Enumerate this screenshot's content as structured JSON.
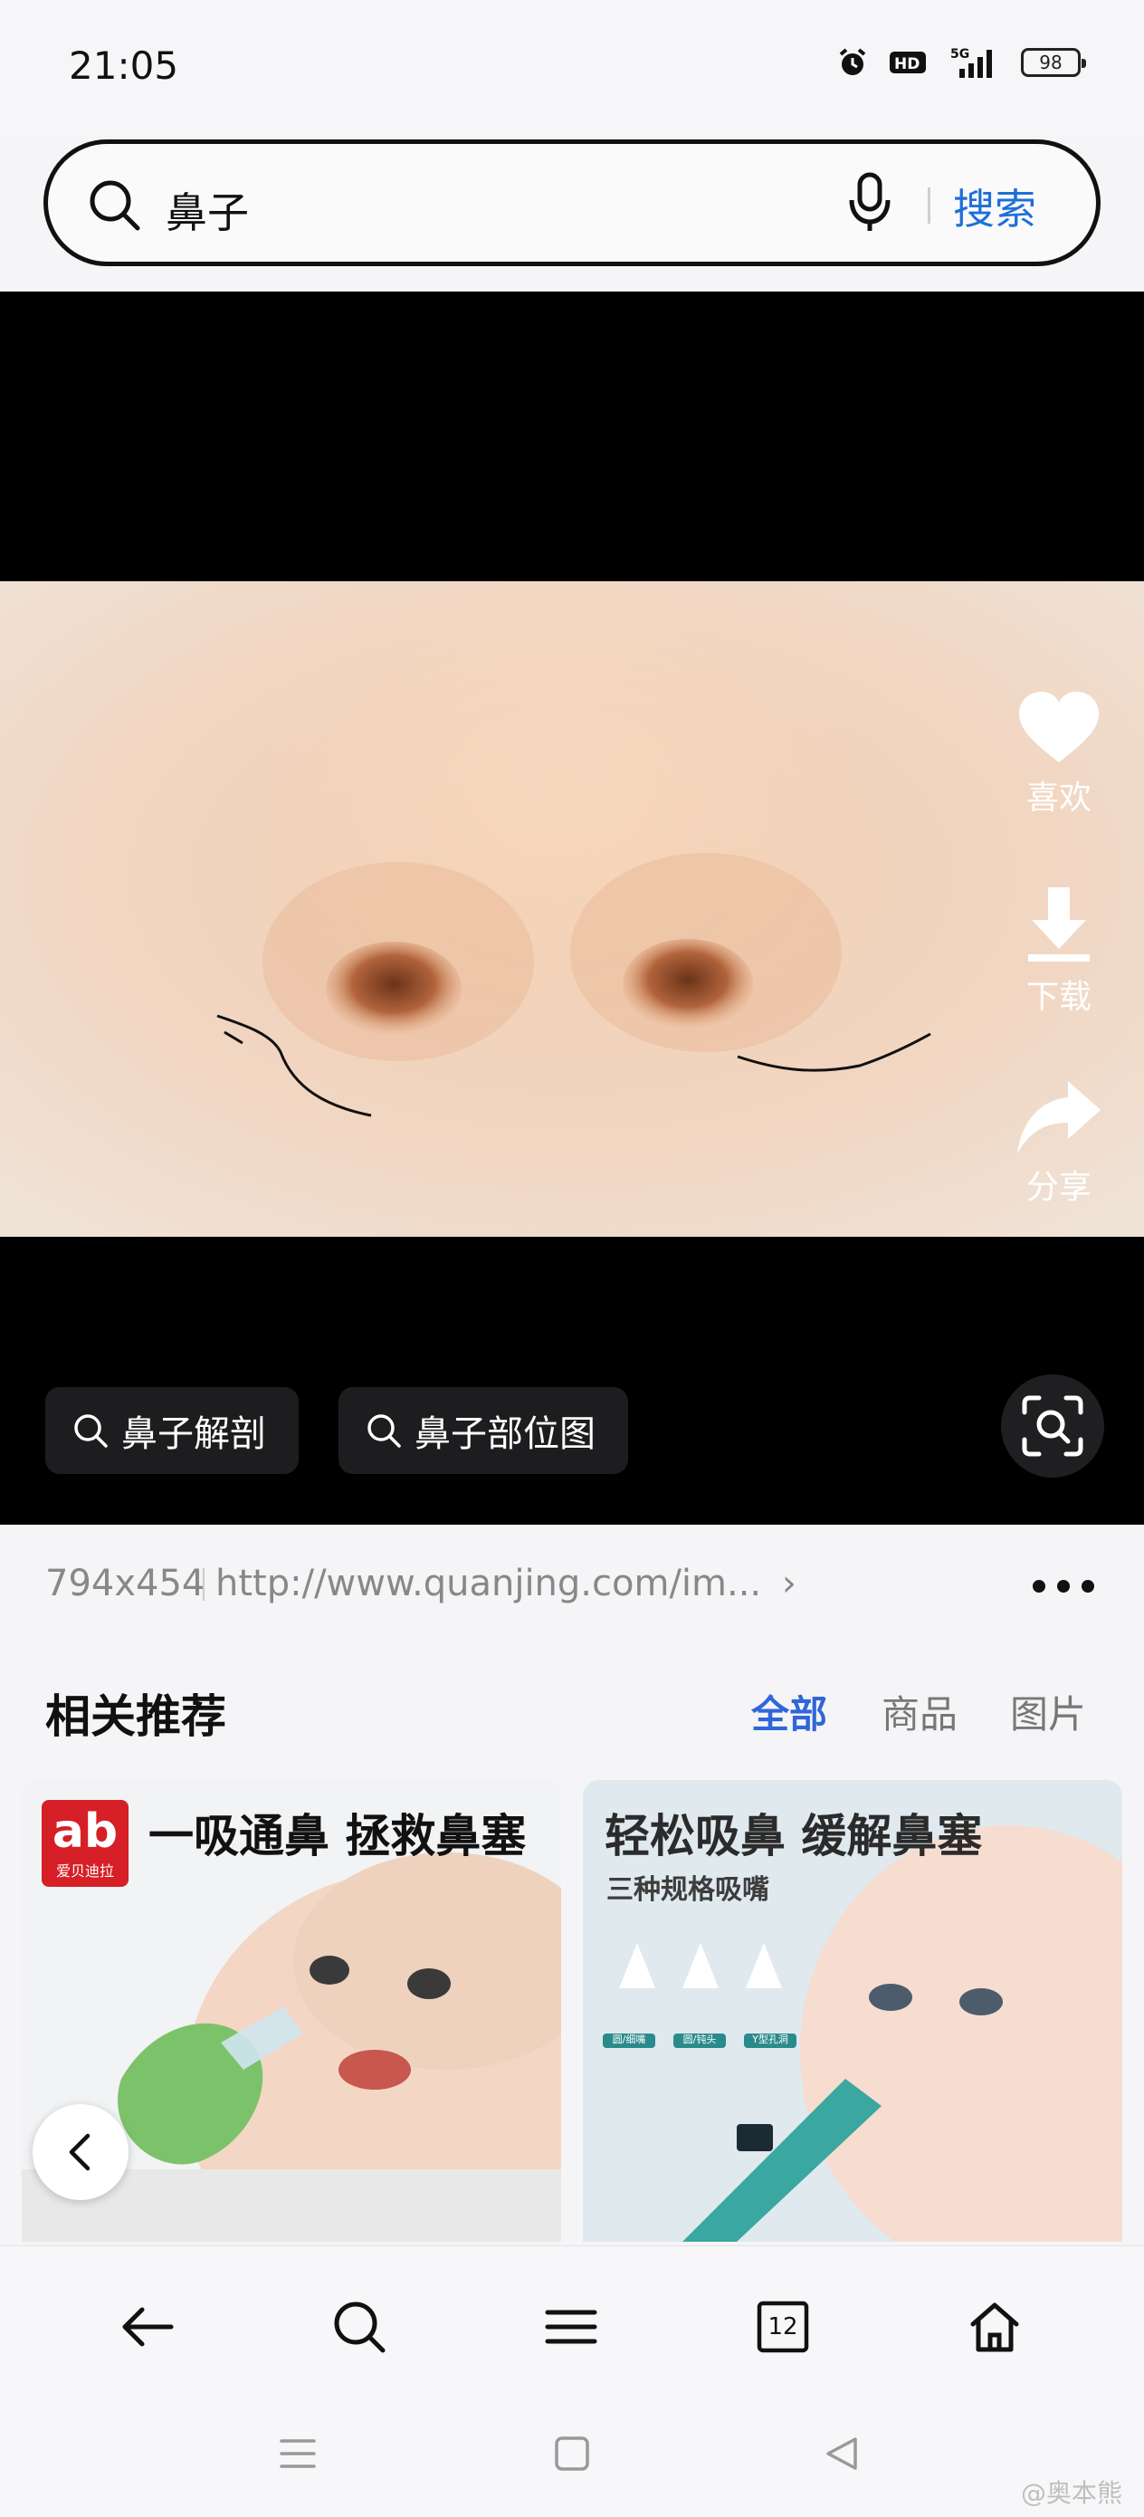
{
  "status_bar": {
    "time": "21:05",
    "battery": "98"
  },
  "search": {
    "query": "鼻子",
    "button_label": "搜索"
  },
  "viewer": {
    "actions": [
      {
        "label": "喜欢",
        "icon": "heart-icon"
      },
      {
        "label": "下载",
        "icon": "download-icon"
      },
      {
        "label": "分享",
        "icon": "share-icon"
      }
    ],
    "chips": [
      "鼻子解剖",
      "鼻子部位图"
    ]
  },
  "info": {
    "size": "794x454",
    "url": "http://www.quanjing.com/im..."
  },
  "related": {
    "title": "相关推荐",
    "tabs": [
      "全部",
      "商品",
      "图片"
    ],
    "cards": [
      {
        "title": "一吸通鼻 拯救鼻塞",
        "brand": "爱贝迪拉",
        "brand_mark": "ab"
      },
      {
        "title": "轻松吸鼻 缓解鼻塞",
        "subtitle": "三种规格吸嘴",
        "tip_labels": [
          "圆/细嘴",
          "圆/钝头",
          "Y型孔洞"
        ]
      }
    ]
  },
  "toolbar": {
    "tabs_count": "12"
  },
  "watermark": "@奥本熊",
  "colors": {
    "accent": "#1e6fd9",
    "tab_active": "#3166d9",
    "brand_red": "#d61f26"
  }
}
